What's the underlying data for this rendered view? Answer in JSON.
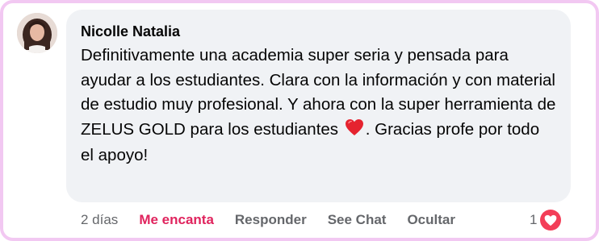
{
  "comment": {
    "author": "Nicolle Natalia",
    "text_part1": "Definitivamente una academia super seria y pensada para ayudar a los estudiantes. Clara con la información y con material de estudio muy profesional. Y ahora con la super herramienta de ZELUS GOLD para los estudiantes",
    "text_part2": ". Gracias profe por todo el apoyo!",
    "emoji": "red-heart"
  },
  "actions": {
    "time": "2 días",
    "love": "Me encanta",
    "reply": "Responder",
    "see_chat": "See Chat",
    "hide": "Ocultar"
  },
  "reactions": {
    "count": "1",
    "type": "love"
  },
  "colors": {
    "frame_border": "#f2c8f2",
    "bubble_bg": "#f0f2f5",
    "love_text": "#e0245e",
    "love_badge": "#f33e58",
    "muted_text": "#65676b"
  }
}
